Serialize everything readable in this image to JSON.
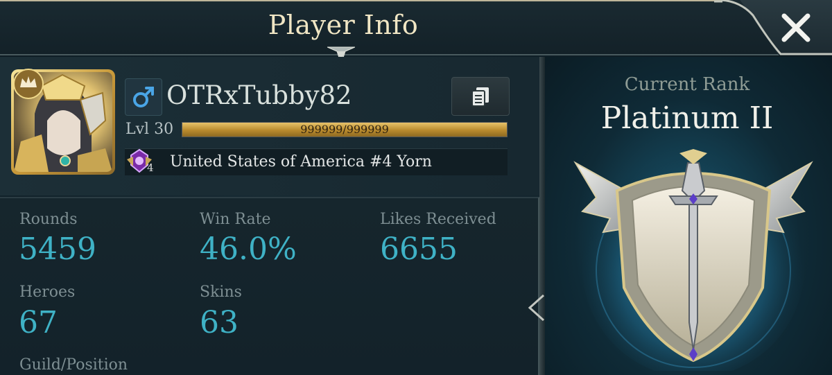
{
  "header": {
    "title": "Player Info"
  },
  "player": {
    "name": "OTRxTubby82",
    "level_label": "Lvl 30",
    "xp_text": "999999/999999",
    "xp_fill_fraction": 1.0,
    "region": {
      "count": "4",
      "text": "United States of America #4 Yorn"
    }
  },
  "stats": {
    "rounds": {
      "label": "Rounds",
      "value": "5459"
    },
    "win_rate": {
      "label": "Win Rate",
      "value": "46.0%"
    },
    "likes": {
      "label": "Likes Received",
      "value": "6655"
    },
    "heroes": {
      "label": "Heroes",
      "value": "67"
    },
    "skins": {
      "label": "Skins",
      "value": "63"
    },
    "guild": {
      "label": "Guild/Position"
    }
  },
  "rank": {
    "label": "Current Rank",
    "name": "Platinum II"
  },
  "icons": {
    "close": "close-icon",
    "copy": "copy-icon",
    "gender": "male-icon",
    "region": "region-crest-icon"
  },
  "colors": {
    "title": "#f0e6c4",
    "stat_value": "#3fb2c6",
    "stat_label": "#7e8f93",
    "xp_bar": "#c99a3a"
  }
}
